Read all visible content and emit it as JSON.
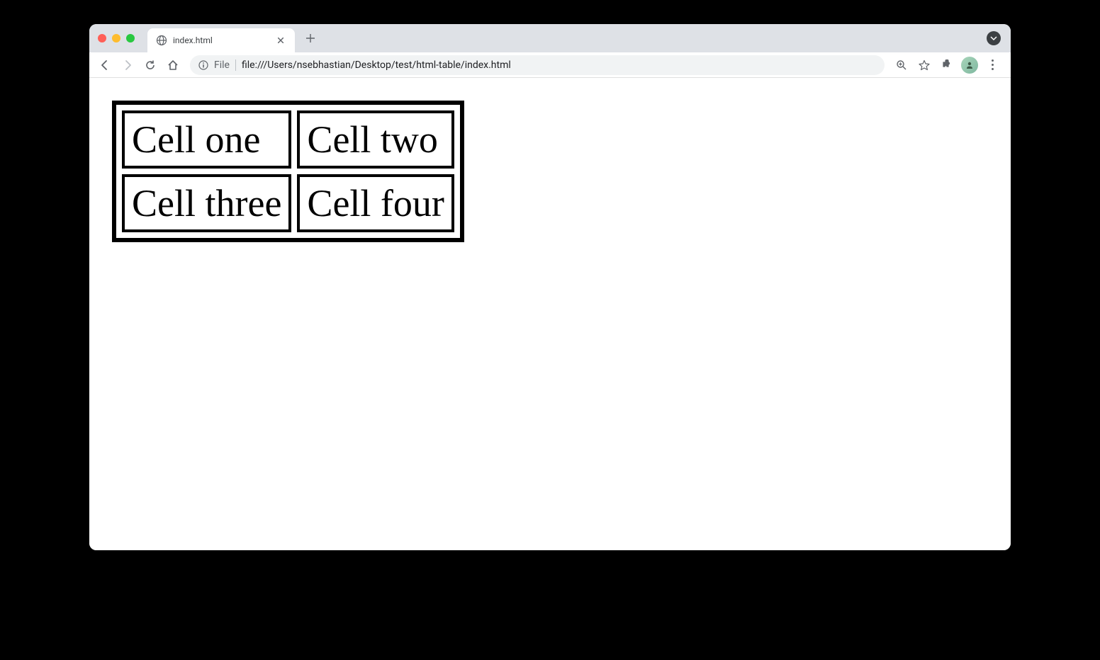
{
  "browser": {
    "tab": {
      "title": "index.html"
    },
    "url": {
      "scheme": "File",
      "path": "file:///Users/nsebhastian/Desktop/test/html-table/index.html"
    }
  },
  "page": {
    "table": {
      "rows": [
        {
          "cells": [
            "Cell one",
            "Cell two"
          ]
        },
        {
          "cells": [
            "Cell three",
            "Cell four"
          ]
        }
      ]
    }
  }
}
